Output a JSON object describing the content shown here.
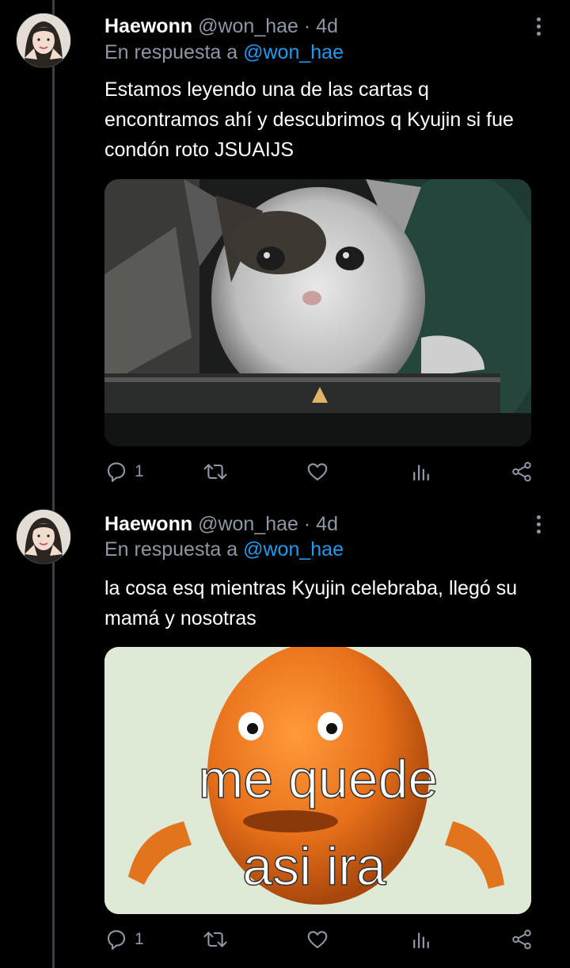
{
  "tweets": [
    {
      "author_name": "Haewonn",
      "author_handle": "@won_hae",
      "separator": "·",
      "time": "4d",
      "reply_prefix": "En respuesta a",
      "reply_mention": "@won_hae",
      "text_lines": [
        "Estamos leyendo una de las cartas q",
        "encontramos ahí y descubrimos q Kyujin si fue",
        "condón roto JSUAIJS"
      ],
      "media": {
        "type": "image",
        "icon": "kitten-photo"
      },
      "reply_count": "1"
    },
    {
      "author_name": "Haewonn",
      "author_handle": "@won_hae",
      "separator": "·",
      "time": "4d",
      "reply_prefix": "En respuesta a",
      "reply_mention": "@won_hae",
      "text_lines": [
        "la cosa esq mientras Kyujin celebraba, llegó su",
        "mamá y nosotras"
      ],
      "media": {
        "type": "image",
        "icon": "orange-meme",
        "caption_line1": "me quede",
        "caption_line2": "asi ira"
      },
      "reply_count": "1"
    }
  ],
  "colors": {
    "background": "#000000",
    "text_primary": "#ffffff",
    "text_secondary": "#8b98a5",
    "accent": "#1d9bf0",
    "thread_line": "#3d4146"
  }
}
